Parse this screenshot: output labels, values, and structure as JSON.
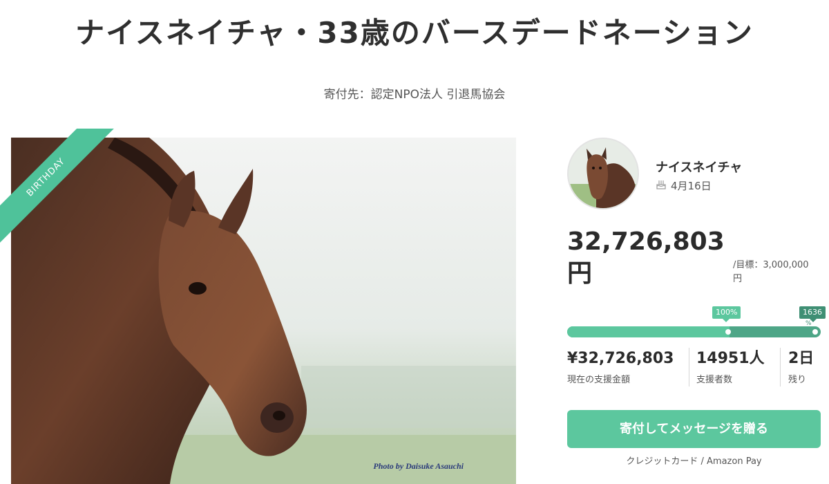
{
  "title": "ナイスネイチャ・33歳のバースデードネーション",
  "recipient": "寄付先：認定NPO法人 引退馬協会",
  "ribbon_label": "BIRTHDAY",
  "photo_credit": "Photo by Daisuke Asauchi",
  "profile": {
    "name": "ナイスネイチャ",
    "birthday_icon": "cake-icon",
    "birthday": "4月16日"
  },
  "funding": {
    "amount_number": "32,726,803",
    "amount_unit": "円",
    "goal_line1": "/目標：3,000,000",
    "goal_line2": "円",
    "progress_fraction": 0.64,
    "marker_1": "100%",
    "marker_2": "1636",
    "marker_2_tail": "%"
  },
  "stats": [
    {
      "value": "¥32,726,803",
      "label": "現在の支援金額"
    },
    {
      "value": "14951人",
      "label": "支援者数"
    },
    {
      "value": "2日",
      "label": "残り"
    }
  ],
  "donate_button": "寄付してメッセージを贈る",
  "payment_methods": "クレジットカード / Amazon Pay",
  "colors": {
    "accent": "#5cc79e",
    "accent_dark": "#3f8f74"
  }
}
